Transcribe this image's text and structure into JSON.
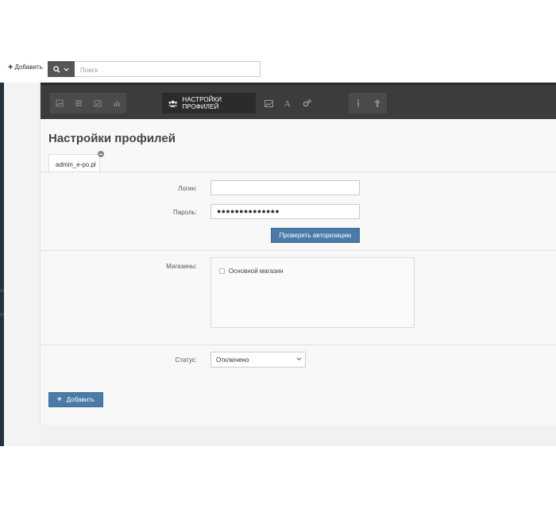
{
  "toolbar": {
    "add_label": "Добавить",
    "search_placeholder": "Поиск"
  },
  "navbar": {
    "left_icons": [
      "image-icon",
      "list-icon",
      "calendar-check-icon",
      "bar-chart-icon"
    ],
    "active_label": "НАСТРОЙКИ ПРОФИЛЕЙ",
    "active_icon": "users-icon",
    "mid_icons": [
      "picture-icon",
      "font-icon",
      "gears-icon"
    ],
    "right_icons": [
      "info-icon",
      "arrow-up-icon"
    ]
  },
  "page": {
    "title": "Настройки профилей"
  },
  "tabs": [
    {
      "label": "admin_e-po.pl"
    }
  ],
  "form": {
    "login_label": "Логин:",
    "login_value": "",
    "password_label": "Пароль:",
    "password_value": "●●●●●●●●●●●●●●",
    "check_auth_label": "Проверить авторизацию",
    "stores_label": "Магазины:",
    "stores": [
      {
        "label": "Основной магазин",
        "checked": false
      }
    ],
    "status_label": "Статус:",
    "status_value": "Отключено",
    "add_button_label": "Добавить"
  },
  "colors": {
    "navbar": "#3c3c3c",
    "primary_button": "#4a7aa8",
    "panel_bg": "#f8f8f8"
  }
}
